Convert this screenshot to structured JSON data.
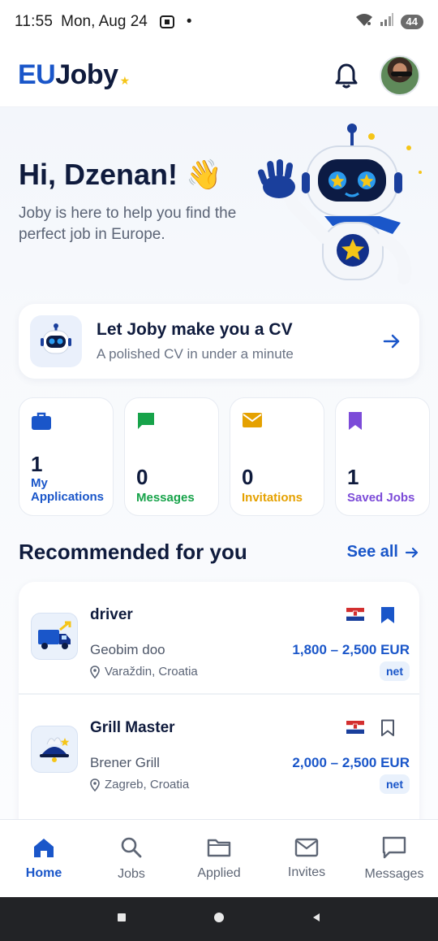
{
  "status_bar": {
    "time": "11:55",
    "date": "Mon, Aug 24",
    "dot": "•",
    "battery": "44"
  },
  "header": {
    "logo_eu": "EU",
    "logo_joby": "Joby",
    "logo_star": "★"
  },
  "hero": {
    "greeting": "Hi, Dzenan! 👋",
    "subtitle": "Joby is here to help you find the perfect job in Europe."
  },
  "cv_card": {
    "title": "Let Joby make you a CV",
    "subtitle": "A polished CV in under a minute"
  },
  "stats": [
    {
      "count": "1",
      "label": "My Applications",
      "color": "#1a56c9",
      "icon": "briefcase-icon"
    },
    {
      "count": "0",
      "label": "Messages",
      "color": "#17a34a",
      "icon": "chat-icon"
    },
    {
      "count": "0",
      "label": "Invitations",
      "color": "#e5a100",
      "icon": "mail-icon"
    },
    {
      "count": "1",
      "label": "Saved Jobs",
      "color": "#7c4bd8",
      "icon": "bookmark-icon"
    }
  ],
  "recommended": {
    "title": "Recommended for you",
    "see_all": "See all",
    "jobs": [
      {
        "title": "driver",
        "company": "Geobim doo",
        "location": "Varaždin, Croatia",
        "salary": "1,800 – 2,500 EUR",
        "net": "net",
        "saved": true
      },
      {
        "title": "Grill Master",
        "company": "Brener Grill",
        "location": "Zagreb, Croatia",
        "salary": "2,000 – 2,500 EUR",
        "net": "net",
        "saved": false
      }
    ]
  },
  "bottom_nav": {
    "items": [
      {
        "label": "Home",
        "icon": "home-icon",
        "active": true
      },
      {
        "label": "Jobs",
        "icon": "search-icon"
      },
      {
        "label": "Applied",
        "icon": "folder-icon"
      },
      {
        "label": "Invites",
        "icon": "mail-icon"
      },
      {
        "label": "Messages",
        "icon": "chat-icon"
      }
    ]
  },
  "colors": {
    "primary": "#1a56c9",
    "dark": "#0f1b3d",
    "green": "#17a34a",
    "amber": "#e5a100",
    "purple": "#7c4bd8"
  }
}
